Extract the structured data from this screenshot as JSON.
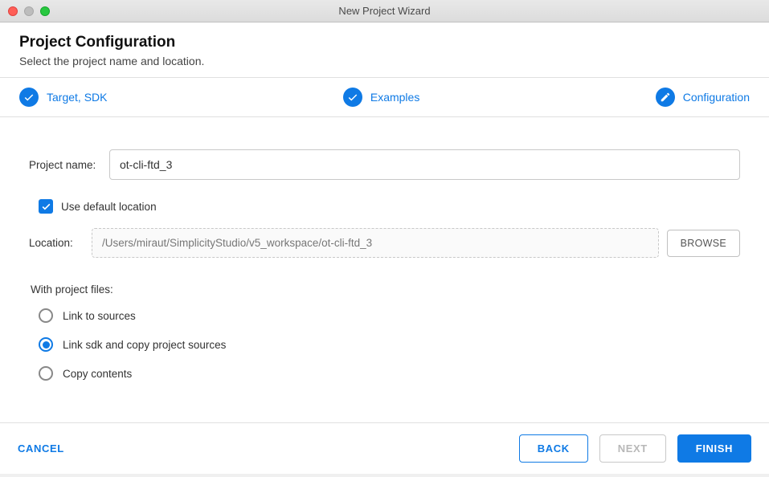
{
  "window": {
    "title": "New Project Wizard"
  },
  "header": {
    "title": "Project Configuration",
    "subtitle": "Select the project name and location."
  },
  "steps": [
    {
      "label": "Target, SDK",
      "icon": "check"
    },
    {
      "label": "Examples",
      "icon": "check"
    },
    {
      "label": "Configuration",
      "icon": "pencil"
    }
  ],
  "form": {
    "projectNameLabel": "Project name:",
    "projectNameValue": "ot-cli-ftd_3",
    "useDefaultLabel": "Use default location",
    "useDefaultChecked": true,
    "locationLabel": "Location:",
    "locationValue": "/Users/miraut/SimplicityStudio/v5_workspace/ot-cli-ftd_3",
    "browseLabel": "BROWSE",
    "withProjectFilesLabel": "With project files:",
    "radioOptions": [
      {
        "label": "Link to sources",
        "selected": false
      },
      {
        "label": "Link sdk and copy project sources",
        "selected": true
      },
      {
        "label": "Copy contents",
        "selected": false
      }
    ]
  },
  "footer": {
    "cancel": "CANCEL",
    "back": "BACK",
    "next": "NEXT",
    "finish": "FINISH"
  }
}
